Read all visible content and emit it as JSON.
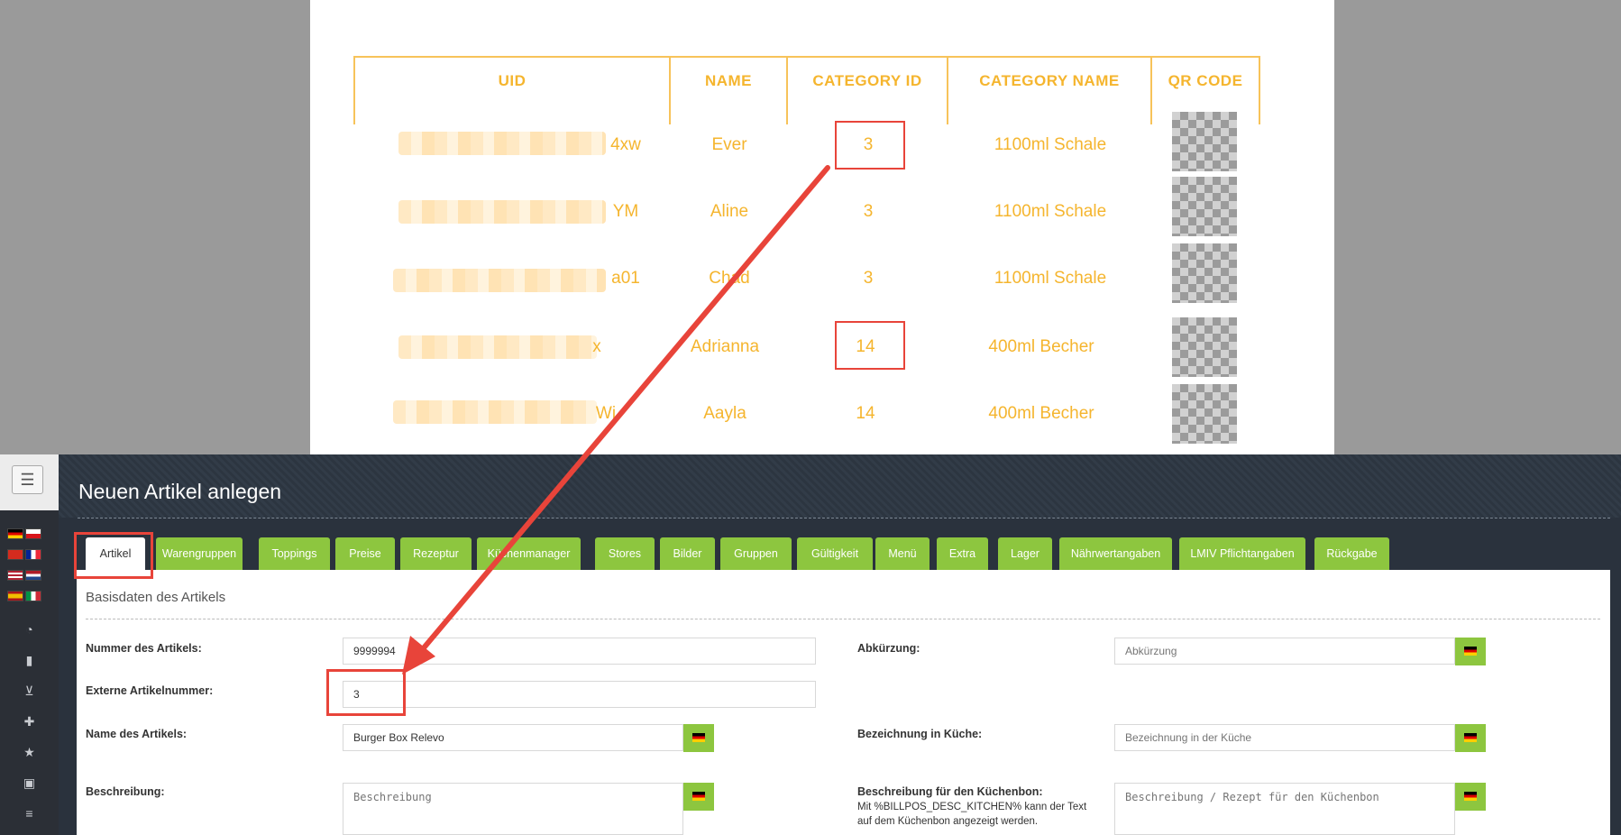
{
  "table": {
    "headers": [
      "UID",
      "NAME",
      "CATEGORY ID",
      "CATEGORY NAME",
      "QR CODE"
    ],
    "rows": [
      {
        "uid_tail": "4xw",
        "name": "Ever",
        "category_id": "3",
        "category_name": "1100ml Schale"
      },
      {
        "uid_tail": "YM",
        "name": "Aline",
        "category_id": "3",
        "category_name": "1100ml Schale"
      },
      {
        "uid_tail": "a01",
        "name": "Chad",
        "category_id": "3",
        "category_name": "1100ml Schale"
      },
      {
        "uid_tail": "x",
        "name": "Adrianna",
        "category_id": "14",
        "category_name": "400ml Becher"
      },
      {
        "uid_tail": "Wj",
        "name": "Aayla",
        "category_id": "14",
        "category_name": "400ml Becher"
      }
    ]
  },
  "app": {
    "menu_icon": "☰",
    "page_title": "Neuen Artikel anlegen",
    "tabs": [
      "Artikel",
      "Warengruppen",
      "Toppings",
      "Preise",
      "Rezeptur",
      "Küchenmanager",
      "Stores",
      "Bilder",
      "Gruppen",
      "Gültigkeit",
      "Menü",
      "Extra",
      "Lager",
      "Nährwertangaben",
      "LMIV Pflichtangaben",
      "Rückgabe"
    ],
    "section_title": "Basisdaten des Artikels",
    "form": {
      "nummer_label": "Nummer des Artikels:",
      "nummer_value": "9999994",
      "extern_label": "Externe Artikelnummer:",
      "extern_value": "3",
      "name_label": "Name des Artikels:",
      "name_value": "Burger Box Relevo",
      "beschreibung_label": "Beschreibung:",
      "beschreibung_placeholder": "Beschreibung",
      "abk_label": "Abkürzung:",
      "abk_placeholder": "Abkürzung",
      "kueche_label": "Bezeichnung in Küche:",
      "kueche_placeholder": "Bezeichnung in der Küche",
      "bon_label": "Beschreibung für den Küchenbon:",
      "bon_hint_1": "Mit %BILLPOS_DESC_KITCHEN% kann der Text",
      "bon_hint_2": "auf dem Küchenbon angezeigt werden.",
      "bon_placeholder": "Beschreibung / Rezept für den Küchenbon"
    }
  },
  "colors": {
    "accent_table": "#f5b52e",
    "tab_green": "#8dc63f",
    "highlight_red": "#e8443a",
    "app_bg": "#2a323d"
  }
}
